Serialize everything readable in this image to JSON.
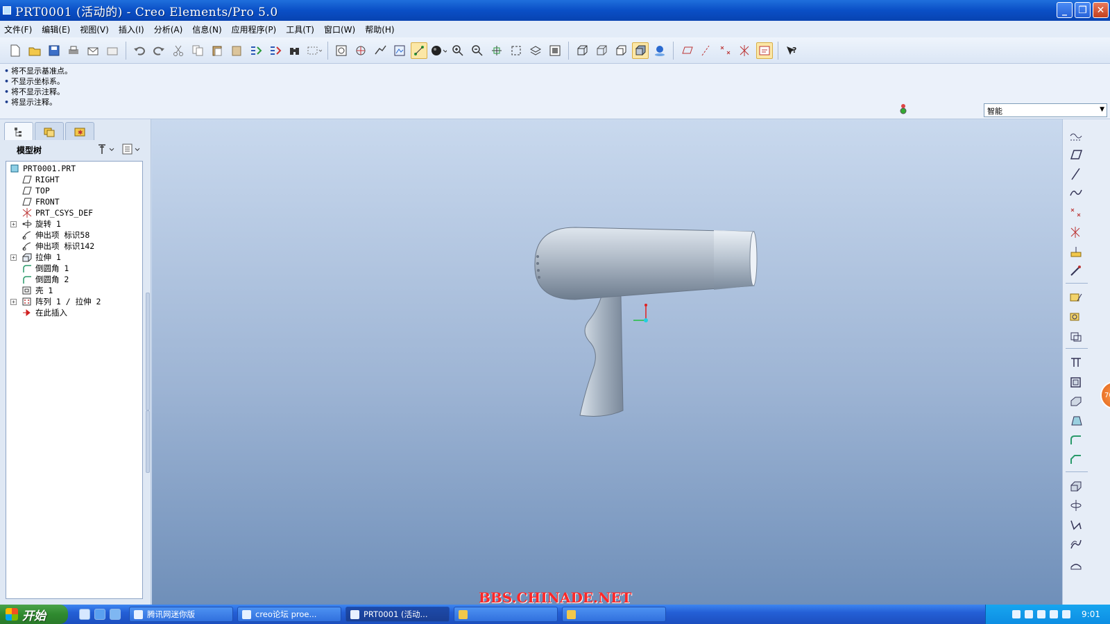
{
  "window": {
    "title": "PRT0001 (活动的) - Creo Elements/Pro 5.0",
    "buttons": [
      "minimize",
      "maximize",
      "close"
    ]
  },
  "menu": [
    "文件(F)",
    "编辑(E)",
    "视图(V)",
    "插入(I)",
    "分析(A)",
    "信息(N)",
    "应用程序(P)",
    "工具(T)",
    "窗口(W)",
    "帮助(H)"
  ],
  "messages": [
    "将不显示基准点。",
    "不显示坐标系。",
    "将不显示注释。",
    "将显示注释。"
  ],
  "filter": {
    "selected": "智能"
  },
  "model_tree": {
    "title": "模型树",
    "items": [
      {
        "label": "PRT0001.PRT",
        "icon": "part-icon",
        "expandable": false
      },
      {
        "label": "RIGHT",
        "icon": "datum-plane-icon",
        "expandable": false
      },
      {
        "label": "TOP",
        "icon": "datum-plane-icon",
        "expandable": false
      },
      {
        "label": "FRONT",
        "icon": "datum-plane-icon",
        "expandable": false
      },
      {
        "label": "PRT_CSYS_DEF",
        "icon": "csys-icon",
        "expandable": false
      },
      {
        "label": "旋转 1",
        "icon": "revolve-icon",
        "expandable": true
      },
      {
        "label": "伸出项 标识58",
        "icon": "protrusion-icon",
        "expandable": false
      },
      {
        "label": "伸出项 标识142",
        "icon": "protrusion-icon",
        "expandable": false
      },
      {
        "label": "拉伸 1",
        "icon": "extrude-icon",
        "expandable": true
      },
      {
        "label": "倒圆角 1",
        "icon": "round-icon",
        "expandable": false
      },
      {
        "label": "倒圆角 2",
        "icon": "round-icon",
        "expandable": false
      },
      {
        "label": "壳 1",
        "icon": "shell-icon",
        "expandable": false
      },
      {
        "label": "阵列 1 / 拉伸 2",
        "icon": "pattern-icon",
        "expandable": true
      },
      {
        "label": "在此插入",
        "icon": "insert-here-icon",
        "expandable": false
      }
    ]
  },
  "taskbar": {
    "start": "开始",
    "tasks": [
      "腾讯网迷你版",
      "creo论坛 proe...",
      "PRT0001 (活动...",
      "",
      ""
    ],
    "clock": "9:01"
  },
  "watermark": "BBS.CHINADE.NET",
  "badge": "70"
}
